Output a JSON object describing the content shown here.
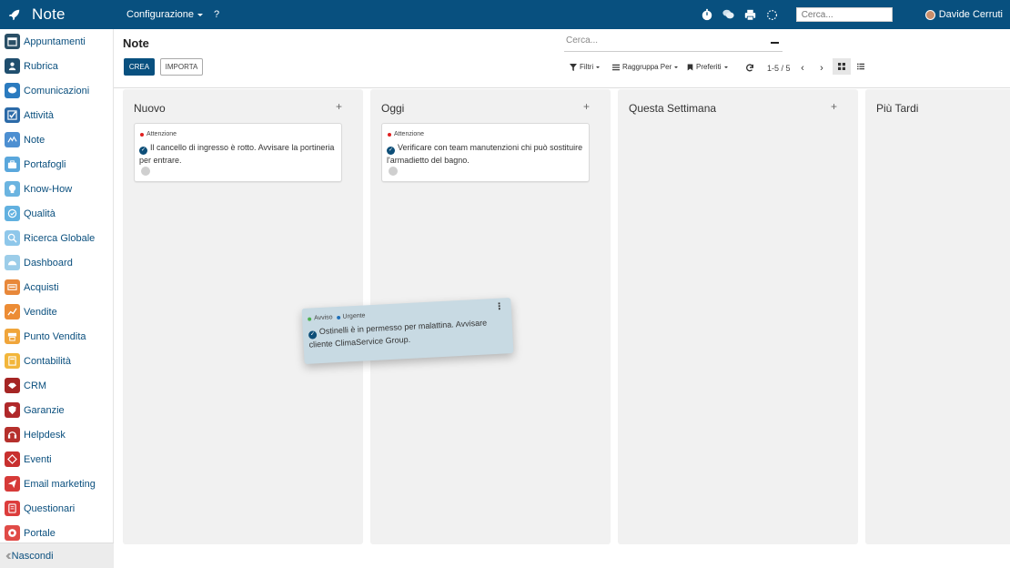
{
  "topbar": {
    "app_title": "Note",
    "menu": [
      {
        "label": "Configurazione"
      },
      {
        "label": "?"
      }
    ],
    "search_placeholder": "Cerca...",
    "user_name": "Davide Cerruti"
  },
  "sidebar": {
    "items": [
      {
        "label": "Appuntamenti",
        "color": "#2a4f66",
        "icon": "calendar-icon"
      },
      {
        "label": "Rubrica",
        "color": "#1f4e6e",
        "icon": "contacts-icon"
      },
      {
        "label": "Comunicazioni",
        "color": "#2b7bbf",
        "icon": "chat-icon"
      },
      {
        "label": "Attività",
        "color": "#2b6aa8",
        "icon": "checkbox-icon"
      },
      {
        "label": "Note",
        "color": "#4d8fd1",
        "icon": "note-icon"
      },
      {
        "label": "Portafogli",
        "color": "#5aa7dc",
        "icon": "briefcase-icon"
      },
      {
        "label": "Know-How",
        "color": "#6bb4e0",
        "icon": "head-icon"
      },
      {
        "label": "Qualità",
        "color": "#62b1e0",
        "icon": "quality-icon"
      },
      {
        "label": "Ricerca Globale",
        "color": "#8ec7ea",
        "icon": "globe-search-icon"
      },
      {
        "label": "Dashboard",
        "color": "#9ccde9",
        "icon": "dashboard-icon"
      },
      {
        "label": "Acquisti",
        "color": "#e8883a",
        "icon": "cart-icon"
      },
      {
        "label": "Vendite",
        "color": "#ec8c35",
        "icon": "chart-icon"
      },
      {
        "label": "Punto Vendita",
        "color": "#f0a53a",
        "icon": "store-icon"
      },
      {
        "label": "Contabilità",
        "color": "#f2b63b",
        "icon": "accounting-icon"
      },
      {
        "label": "CRM",
        "color": "#a52524",
        "icon": "crm-icon"
      },
      {
        "label": "Garanzie",
        "color": "#b0282a",
        "icon": "shield-icon"
      },
      {
        "label": "Helpdesk",
        "color": "#b5302c",
        "icon": "headset-icon"
      },
      {
        "label": "Eventi",
        "color": "#c8302f",
        "icon": "event-icon"
      },
      {
        "label": "Email marketing",
        "color": "#d63a38",
        "icon": "send-icon"
      },
      {
        "label": "Questionari",
        "color": "#dc3d3c",
        "icon": "survey-icon"
      },
      {
        "label": "Portale",
        "color": "#e04b47",
        "icon": "portal-icon"
      }
    ],
    "hide_label": "Nascondi"
  },
  "control": {
    "page_title": "Note",
    "search_placeholder": "Cerca...",
    "create_label": "CREA",
    "import_label": "IMPORTA",
    "filters_label": "Filtri",
    "group_label": "Raggruppa Per",
    "favorites_label": "Preferiti",
    "pager": "1-5 / 5"
  },
  "kanban": {
    "columns": [
      {
        "title": "Nuovo"
      },
      {
        "title": "Oggi"
      },
      {
        "title": "Questa Settimana"
      },
      {
        "title": "Più Tardi"
      }
    ],
    "cards": [
      {
        "tag": "Attenzione",
        "tag_color": "#e02020",
        "text": "Il cancello di ingresso è rotto. Avvisare la portineria per entrare."
      },
      {
        "tag": "Attenzione",
        "tag_color": "#e02020",
        "text": "Verificare con team manutenzioni chi può sostituire l'armadietto del bagno."
      }
    ],
    "dragged_card": {
      "tags": [
        {
          "label": "Avviso",
          "color": "#4caf50"
        },
        {
          "label": "Urgente",
          "color": "#1e6fb8"
        }
      ],
      "text": "Ostinelli è in permesso per malattina. Avvisare cliente ClimaService Group."
    }
  }
}
